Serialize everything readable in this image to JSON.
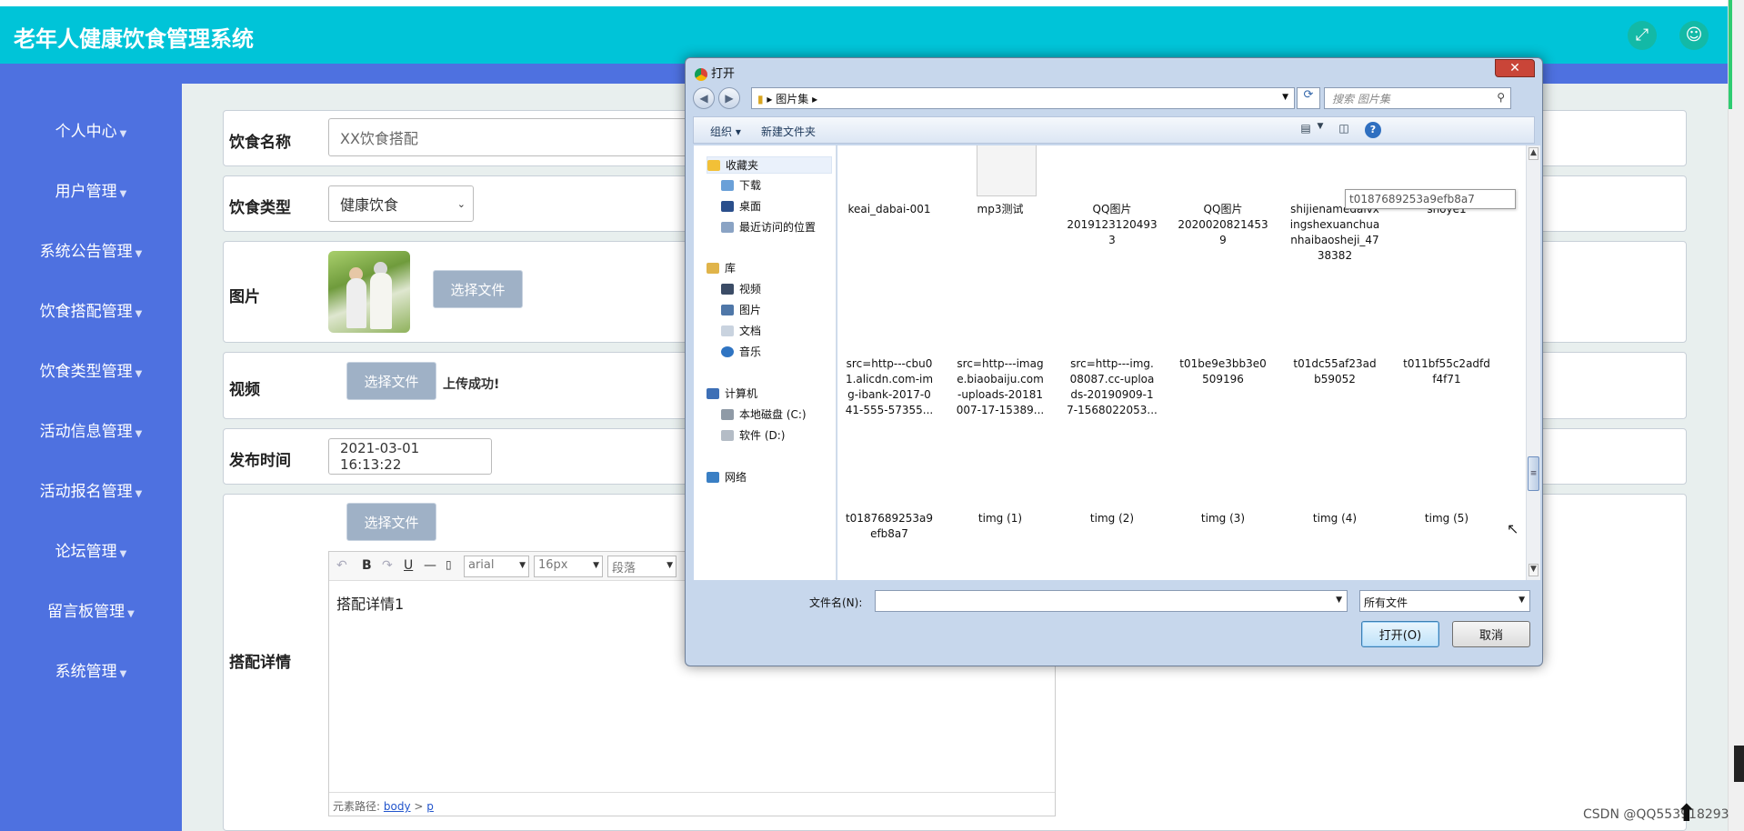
{
  "header": {
    "app_title": "老年人健康饮食管理系统"
  },
  "sidebar": {
    "items": [
      {
        "label": "个人中心"
      },
      {
        "label": "用户管理"
      },
      {
        "label": "系统公告管理"
      },
      {
        "label": "饮食搭配管理"
      },
      {
        "label": "饮食类型管理"
      },
      {
        "label": "活动信息管理"
      },
      {
        "label": "活动报名管理"
      },
      {
        "label": "论坛管理"
      },
      {
        "label": "留言板管理"
      },
      {
        "label": "系统管理"
      }
    ]
  },
  "form": {
    "name_label": "饮食名称",
    "name_value": "XX饮食搭配",
    "type_label": "饮食类型",
    "type_value": "健康饮食",
    "image_label": "图片",
    "choose_file": "选择文件",
    "video_label": "视频",
    "upload_success": "上传成功!",
    "publish_label": "发布时间",
    "publish_value": "2021-03-01 16:13:22",
    "detail_label": "搭配详情"
  },
  "editor": {
    "bold": "B",
    "underline": "U",
    "font_family": "arial",
    "font_size": "16px",
    "paragraph": "段落",
    "content": "搭配详情1",
    "path_label": "元素路径:",
    "path_body": "body",
    "path_sep": ">",
    "path_p": "p"
  },
  "dialog": {
    "title": "打开",
    "close": "✕",
    "path": "图片集",
    "search_placeholder": "搜索 图片集",
    "organize": "组织",
    "new_folder": "新建文件夹",
    "tree": [
      {
        "label": "收藏夹"
      },
      {
        "label": "下载"
      },
      {
        "label": "桌面"
      },
      {
        "label": "最近访问的位置"
      },
      {
        "label": "库"
      },
      {
        "label": "视频"
      },
      {
        "label": "图片"
      },
      {
        "label": "文档"
      },
      {
        "label": "音乐"
      },
      {
        "label": "计算机"
      },
      {
        "label": "本地磁盘 (C:)"
      },
      {
        "label": "软件 (D:)"
      },
      {
        "label": "网络"
      }
    ],
    "tooltip": "t0187689253a9efb8a7",
    "files": [
      "keai_dabai-001",
      "mp3测试",
      "QQ图片\n2019123120493\n3",
      "QQ图片\n2020020821453\n9",
      "shijienamedaivx\ningshexuanchua\nnhaibaosheji_47\n38382",
      "shoye1",
      "src=http---cbu0\n1.alicdn.com-im\ng-ibank-2017-0\n41-555-57355...",
      "src=http---imag\ne.biaobaiju.com\n-uploads-20181\n007-17-15389...",
      "src=http---img.\n08087.cc-uploa\nds-20190909-1\n7-1568022053...",
      "t01be9e3bb3e0\n509196",
      "t01dc55af23ad\nb59052",
      "t011bf55c2adfd\nf4f71",
      "t0187689253a9\nefb8a7",
      "timg (1)",
      "timg (2)",
      "timg (3)",
      "timg (4)",
      "timg (5)"
    ],
    "filename_label": "文件名(N):",
    "filename_value": "",
    "filter": "所有文件",
    "open_button": "打开(O)",
    "cancel_button": "取消"
  },
  "watermark": "CSDN @QQ553918293"
}
